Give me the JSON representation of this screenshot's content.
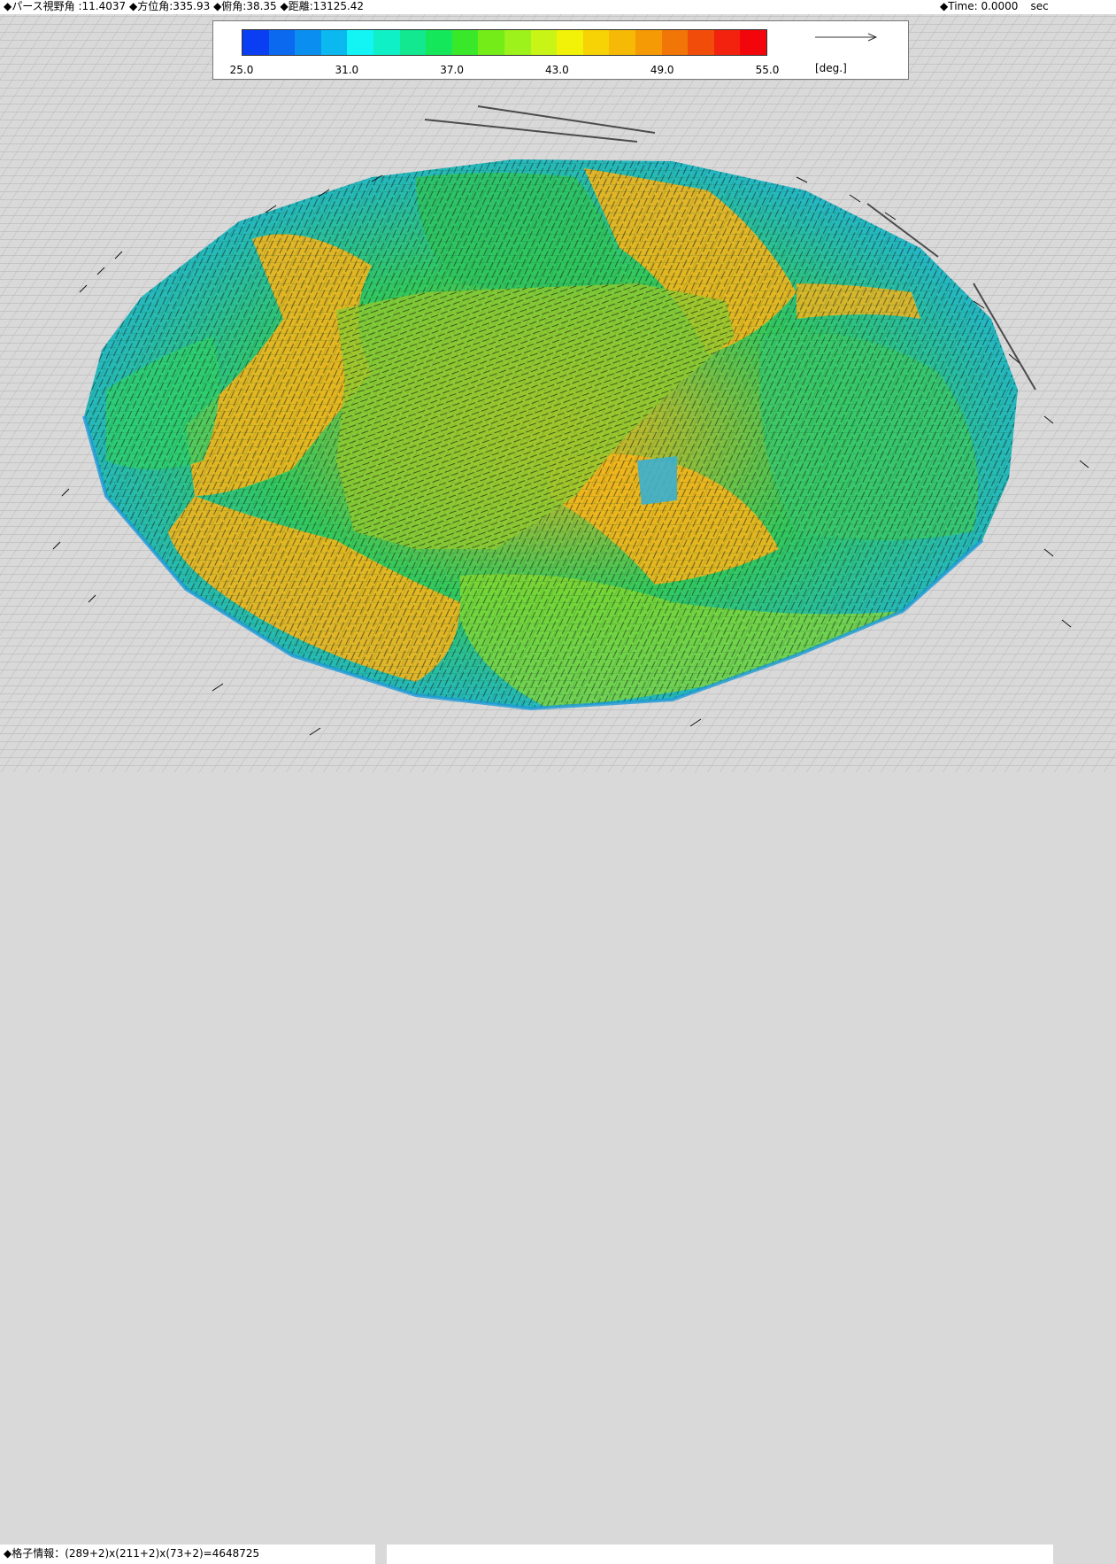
{
  "camera": {
    "perspective_label": "◆パース視野角",
    "perspective_value": ":11.4037",
    "azimuth_label": "◆方位角",
    "azimuth_value": ":335.93",
    "elevation_label": "◆俯角",
    "elevation_value": ":38.35",
    "distance_label": "◆距離",
    "distance_value": ":13125.42"
  },
  "time": {
    "label": "◆Time: 0.0000",
    "unit": "sec"
  },
  "legend": {
    "ticks": [
      "25.0",
      "31.0",
      "37.0",
      "43.0",
      "49.0",
      "55.0"
    ],
    "unit": "[deg.]",
    "colors": [
      "#0a3ef2",
      "#0b69f0",
      "#0a8ff0",
      "#0bb8f0",
      "#13f5f5",
      "#10f0c6",
      "#12e88f",
      "#14e85a",
      "#3ae82a",
      "#74ec18",
      "#9cf21a",
      "#c8f516",
      "#f2f208",
      "#f7d205",
      "#f5b906",
      "#f59a05",
      "#f27508",
      "#f24c0a",
      "#f2220e",
      "#f2060c"
    ]
  },
  "status": {
    "grid_info": "◆格子情報：(289+2)x(211+2)x(73+2)=4648725"
  },
  "scene": {
    "colors": {
      "background": "#d9d9d9",
      "grid_line": "#a8a8a8",
      "low": "#2fb6ea",
      "mid": "#2fcf6a",
      "mid2": "#8fdc2a",
      "high": "#f5b51c",
      "vector": "#111111"
    }
  }
}
